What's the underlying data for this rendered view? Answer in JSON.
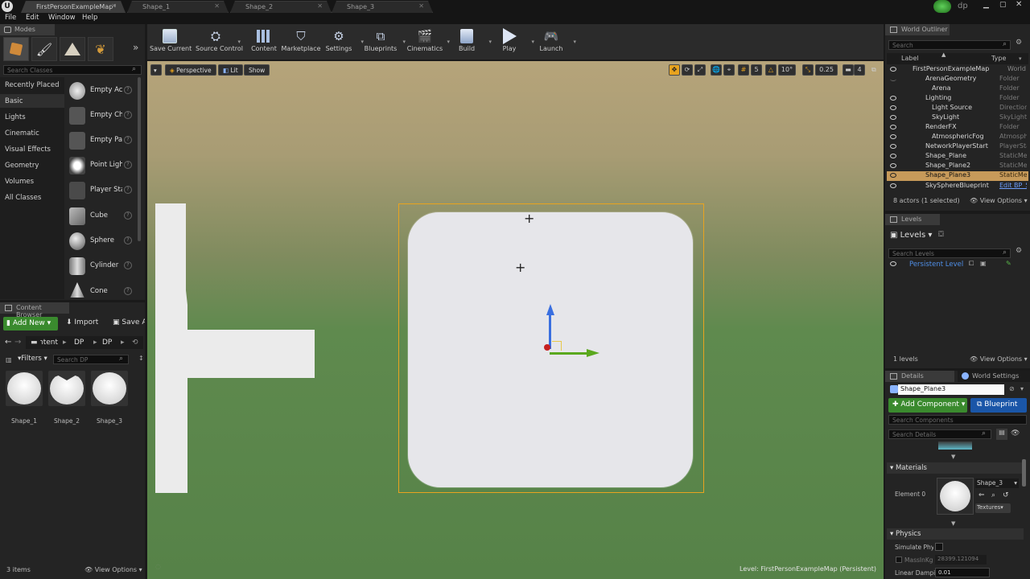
{
  "app": {
    "logo": "unreal-logo",
    "user_initials": "dp"
  },
  "tabs": [
    {
      "label": "FirstPersonExampleMap*",
      "active": true
    },
    {
      "label": "Shape_1",
      "active": false
    },
    {
      "label": "Shape_2",
      "active": false
    },
    {
      "label": "Shape_3",
      "active": false
    }
  ],
  "menu": [
    "File",
    "Edit",
    "Window",
    "Help"
  ],
  "modes": {
    "title": "Modes",
    "search_placeholder": "Search Classes",
    "categories": [
      "Recently Placed",
      "Basic",
      "Lights",
      "Cinematic",
      "Visual Effects",
      "Geometry",
      "Volumes",
      "All Classes"
    ],
    "selected_category": "Basic",
    "items": [
      "Empty Actor",
      "Empty Character",
      "Empty Pawn",
      "Point Light",
      "Player Start",
      "Cube",
      "Sphere",
      "Cylinder",
      "Cone"
    ]
  },
  "content_browser": {
    "title": "Content Browser",
    "add_new": "Add New",
    "import": "Import",
    "save_all": "Save All",
    "path": [
      "Content",
      "DP",
      "DP"
    ],
    "filters": "Filters",
    "search_placeholder": "Search DP",
    "assets": [
      "Shape_1",
      "Shape_2",
      "Shape_3"
    ],
    "item_count": "3 items",
    "view_options": "View Options"
  },
  "toolbar": [
    {
      "label": "Save Current",
      "icon": "save-icon",
      "dropdown": false
    },
    {
      "label": "Source Control",
      "icon": "source-control-icon",
      "dropdown": true
    },
    {
      "label": "Content",
      "icon": "content-icon",
      "dropdown": false
    },
    {
      "label": "Marketplace",
      "icon": "marketplace-icon",
      "dropdown": false
    },
    {
      "label": "Settings",
      "icon": "settings-icon",
      "dropdown": true
    },
    {
      "label": "Blueprints",
      "icon": "blueprints-icon",
      "dropdown": true
    },
    {
      "label": "Cinematics",
      "icon": "cinematics-icon",
      "dropdown": true
    },
    {
      "label": "Build",
      "icon": "build-icon",
      "dropdown": true
    },
    {
      "label": "Play",
      "icon": "play-icon",
      "dropdown": true
    },
    {
      "label": "Launch",
      "icon": "launch-icon",
      "dropdown": true
    }
  ],
  "viewport": {
    "view_mode": "Perspective",
    "lighting": "Lit",
    "show": "Show",
    "grid_snap": "5",
    "rotation_snap": "10°",
    "scale_snap": "0.25",
    "camera_speed": "4",
    "level_label": "Level:",
    "level_name": "FirstPersonExampleMap (Persistent)"
  },
  "world_outliner": {
    "title": "World Outliner",
    "search_placeholder": "Search",
    "col_label": "Label",
    "col_type": "Type",
    "rows": [
      {
        "label": "FirstPersonExampleMap",
        "type": "World",
        "indent": 0,
        "selected": false
      },
      {
        "label": "ArenaGeometry",
        "type": "Folder",
        "indent": 1,
        "selected": false
      },
      {
        "label": "Arena",
        "type": "Folder",
        "indent": 2,
        "selected": false
      },
      {
        "label": "Lighting",
        "type": "Folder",
        "indent": 1,
        "selected": false
      },
      {
        "label": "Light Source",
        "type": "DirectionalLight",
        "indent": 2,
        "selected": false
      },
      {
        "label": "SkyLight",
        "type": "SkyLight",
        "indent": 2,
        "selected": false
      },
      {
        "label": "RenderFX",
        "type": "Folder",
        "indent": 1,
        "selected": false
      },
      {
        "label": "AtmosphericFog",
        "type": "AtmosphericFog",
        "indent": 2,
        "selected": false
      },
      {
        "label": "NetworkPlayerStart",
        "type": "PlayerStart",
        "indent": 1,
        "selected": false
      },
      {
        "label": "Shape_Plane",
        "type": "StaticMeshActor",
        "indent": 1,
        "selected": false
      },
      {
        "label": "Shape_Plane2",
        "type": "StaticMeshActor",
        "indent": 1,
        "selected": false
      },
      {
        "label": "Shape_Plane3",
        "type": "StaticMeshActor",
        "indent": 1,
        "selected": true
      },
      {
        "label": "SkySphereBlueprint",
        "type": "Edit BP_Sky",
        "indent": 1,
        "selected": false
      }
    ],
    "status": "8 actors (1 selected)",
    "view_options": "View Options"
  },
  "levels": {
    "title": "Levels",
    "header": "Levels",
    "search_placeholder": "Search Levels",
    "persistent_level": "Persistent Level",
    "count": "1 levels",
    "view_options": "View Options"
  },
  "details": {
    "tab_details": "Details",
    "tab_world_settings": "World Settings",
    "actor_name": "Shape_Plane3",
    "add_component": "Add Component",
    "blueprint": "Blueprint",
    "search_components_placeholder": "Search Components",
    "search_details_placeholder": "Search Details",
    "materials_header": "Materials",
    "element_label": "Element 0",
    "material_name": "Shape_3",
    "textures": "Textures",
    "physics_header": "Physics",
    "simulate_physics": "Simulate Physics",
    "mass_label": "MassInKg",
    "mass_value": "28399.121094",
    "linear_damping_label": "Linear Damping",
    "linear_damping_value": "0.01"
  },
  "colors": {
    "selection_orange": "#e8a31f",
    "add_green": "#3a8a2e",
    "blueprint_blue": "#1a56a8",
    "outliner_highlight": "#c79a5a"
  }
}
